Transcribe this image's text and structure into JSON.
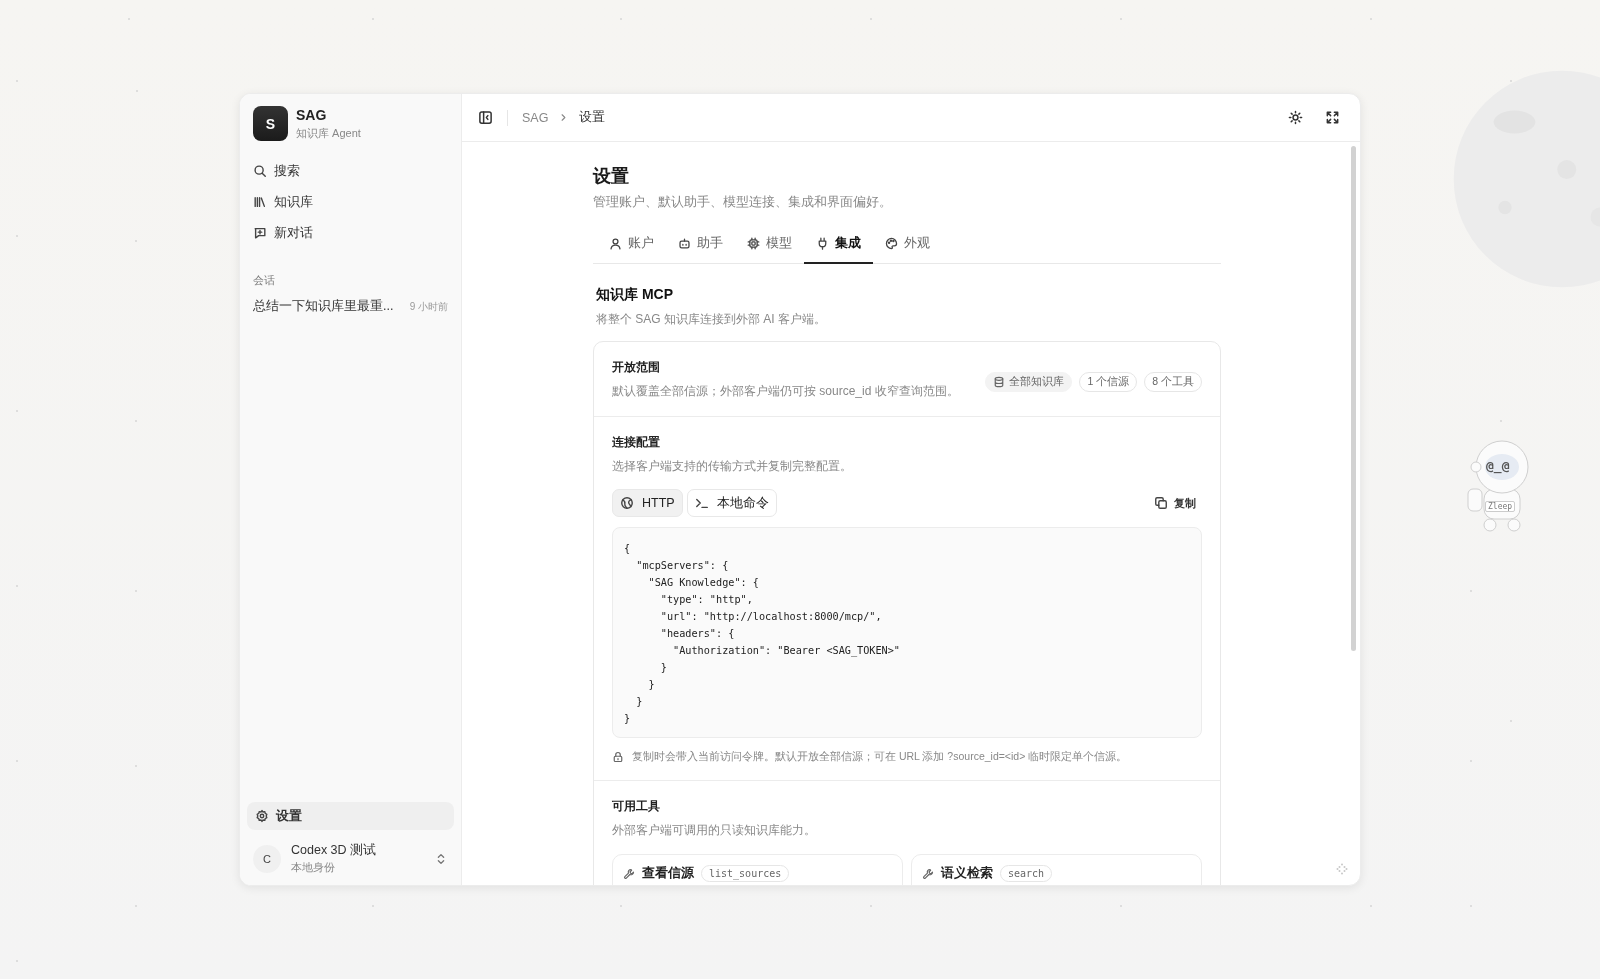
{
  "sidebar": {
    "brand": {
      "avatar": "S",
      "name": "SAG",
      "subtitle": "知识库 Agent"
    },
    "nav": [
      {
        "label": "搜索",
        "selected": false
      },
      {
        "label": "知识库",
        "selected": false
      },
      {
        "label": "新对话",
        "selected": false
      }
    ],
    "sessions_heading": "会话",
    "sessions": [
      {
        "title": "总结一下知识库里最重...",
        "time": "9 小时前"
      }
    ],
    "settings": {
      "label": "设置",
      "selected": true
    },
    "user": {
      "avatar": "C",
      "name": "Codex 3D 测试",
      "subtitle": "本地身份"
    }
  },
  "header": {
    "breadcrumb": [
      "SAG",
      "设置"
    ]
  },
  "page": {
    "title": "设置",
    "subtitle": "管理账户、默认助手、模型连接、集成和界面偏好。",
    "tabs": [
      {
        "label": "账户",
        "selected": false
      },
      {
        "label": "助手",
        "selected": false
      },
      {
        "label": "模型",
        "selected": false
      },
      {
        "label": "集成",
        "selected": true
      },
      {
        "label": "外观",
        "selected": false
      }
    ]
  },
  "mcp": {
    "title": "知识库 MCP",
    "description": "将整个 SAG 知识库连接到外部 AI 客户端。",
    "scope": {
      "title": "开放范围",
      "description": "默认覆盖全部信源；外部客户端仍可按 source_id 收窄查询范围。",
      "badges": [
        "全部知识库",
        "1 个信源",
        "8 个工具"
      ]
    },
    "connection": {
      "title": "连接配置",
      "description": "选择客户端支持的传输方式并复制完整配置。",
      "transports": [
        {
          "label": "HTTP",
          "selected": true
        },
        {
          "label": "本地命令",
          "selected": false
        }
      ],
      "copy": "复制",
      "code": "{\n  \"mcpServers\": {\n    \"SAG Knowledge\": {\n      \"type\": \"http\",\n      \"url\": \"http://localhost:8000/mcp/\",\n      \"headers\": {\n        \"Authorization\": \"Bearer <SAG_TOKEN>\"\n      }\n    }\n  }\n}",
      "note": "复制时会带入当前访问令牌。默认开放全部信源；可在 URL 添加 ?source_id=<id> 临时限定单个信源。"
    },
    "tools": {
      "title": "可用工具",
      "description": "外部客户端可调用的只读知识库能力。",
      "items": [
        {
          "name": "查看信源",
          "code": "list_sources"
        },
        {
          "name": "语义检索",
          "code": "search"
        }
      ]
    }
  },
  "mascot": {
    "face": "@_@",
    "tag": "Zleep"
  }
}
